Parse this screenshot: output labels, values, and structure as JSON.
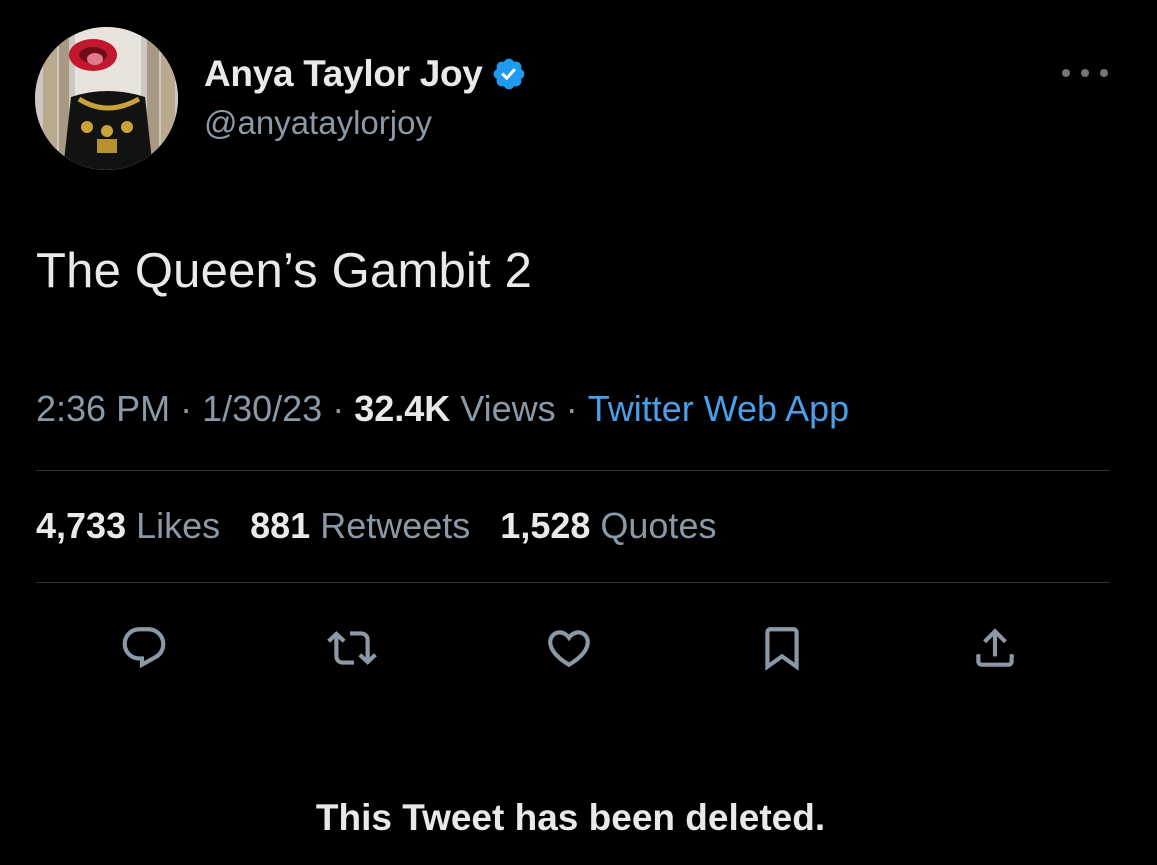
{
  "author": {
    "display_name": "Anya Taylor Joy",
    "handle": "@anyataylorjoy",
    "verified": true,
    "avatar_icon": "profile-photo"
  },
  "tweet": {
    "text": "The Queen’s Gambit 2",
    "time": "2:36 PM",
    "date": "1/30/23",
    "views_count": "32.4K",
    "views_label": "Views",
    "source": "Twitter Web App",
    "separator": "·"
  },
  "stats": {
    "likes_count": "4,733",
    "likes_label": "Likes",
    "retweets_count": "881",
    "retweets_label": "Retweets",
    "quotes_count": "1,528",
    "quotes_label": "Quotes"
  },
  "actions": [
    "reply-icon",
    "retweet-icon",
    "like-icon",
    "bookmark-icon",
    "share-icon"
  ],
  "status_message": "This Tweet has been deleted.",
  "colors": {
    "background": "#000000",
    "primary_text": "#e7e9ea",
    "secondary_text": "#8b98a5",
    "link": "#4a9fe8",
    "verified_badge": "#1d9bf0",
    "divider": "#2f3336"
  }
}
